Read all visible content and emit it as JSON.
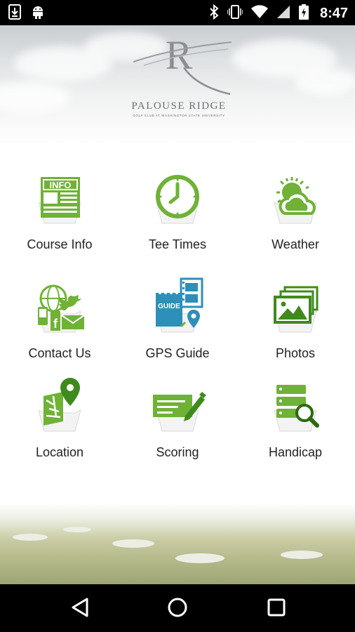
{
  "status_bar": {
    "time": "8:47",
    "icons_left": [
      "download-icon",
      "android-icon"
    ],
    "icons_right": [
      "bluetooth-icon",
      "vibrate-icon",
      "wifi-icon",
      "cell-signal-icon",
      "battery-charging-icon"
    ]
  },
  "logo": {
    "letter": "R",
    "name": "PALOUSE RIDGE",
    "subtitle": "GOLF CLUB AT WASHINGTON STATE UNIVERSITY"
  },
  "menu": [
    {
      "label": "Course Info",
      "icon": "info-newspaper-icon"
    },
    {
      "label": "Tee Times",
      "icon": "clock-icon"
    },
    {
      "label": "Weather",
      "icon": "sun-cloud-icon"
    },
    {
      "label": "Contact Us",
      "icon": "social-contact-icon"
    },
    {
      "label": "GPS Guide",
      "icon": "gps-guide-icon"
    },
    {
      "label": "Photos",
      "icon": "photos-icon"
    },
    {
      "label": "Location",
      "icon": "map-pin-icon"
    },
    {
      "label": "Scoring",
      "icon": "scorecard-pencil-icon"
    },
    {
      "label": "Handicap",
      "icon": "handicap-search-icon"
    }
  ],
  "icon_text": {
    "info": "INFO",
    "guide": "GUIDE"
  },
  "colors": {
    "accent_green": "#6fb236",
    "dark_green": "#3f8a1c",
    "accent_blue": "#2e8fb8"
  },
  "nav_bar": [
    "back-icon",
    "home-icon",
    "recents-icon"
  ]
}
